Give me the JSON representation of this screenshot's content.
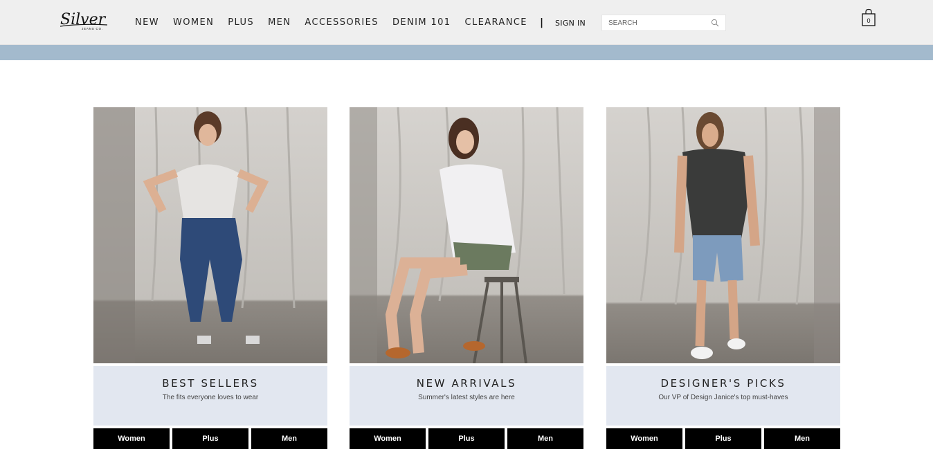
{
  "header": {
    "logo_text": "Silver",
    "logo_subtext": "JEANS CO.",
    "nav": [
      "NEW",
      "WOMEN",
      "PLUS",
      "MEN",
      "ACCESSORIES",
      "DENIM 101",
      "CLEARANCE"
    ],
    "separator": "|",
    "sign_in": "SIGN IN",
    "search_placeholder": "SEARCH",
    "cart_count": "0"
  },
  "colors": {
    "header_bg": "#efefef",
    "banner_strip": "#a3bacd",
    "card_info_bg": "#e2e7f0",
    "button_bg": "#000000"
  },
  "cards": [
    {
      "title": "BEST SELLERS",
      "subtitle": "The fits everyone loves to wear",
      "buttons": [
        "Women",
        "Plus",
        "Men"
      ]
    },
    {
      "title": "NEW ARRIVALS",
      "subtitle": "Summer's latest styles are here",
      "buttons": [
        "Women",
        "Plus",
        "Men"
      ]
    },
    {
      "title": "DESIGNER'S PICKS",
      "subtitle": "Our VP of Design Janice's top must-haves",
      "buttons": [
        "Women",
        "Plus",
        "Men"
      ]
    }
  ]
}
